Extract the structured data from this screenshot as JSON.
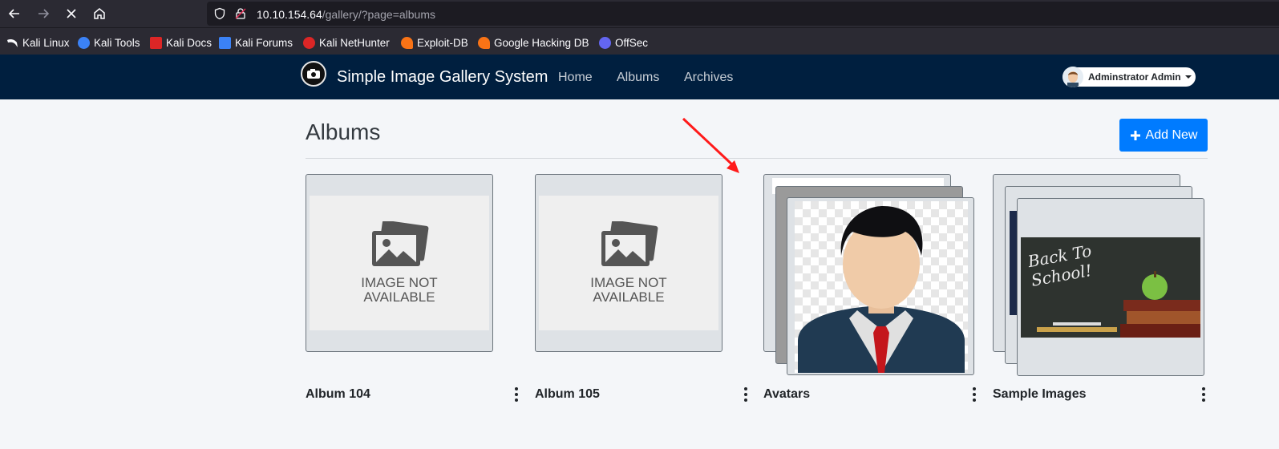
{
  "browser": {
    "url_host": "10.10.154.64",
    "url_path": "/gallery/?page=albums",
    "icons": [
      "back-icon",
      "forward-icon",
      "stop-icon",
      "home-icon",
      "shield-icon",
      "lock-icon"
    ],
    "bookmarks": [
      {
        "label": "Kali Linux",
        "icon": "kali-icon",
        "color": "#fbfbfe"
      },
      {
        "label": "Kali Tools",
        "icon": "kali-tools-icon",
        "color": "#3b82f6"
      },
      {
        "label": "Kali Docs",
        "icon": "kali-docs-icon",
        "color": "#dc2626"
      },
      {
        "label": "Kali Forums",
        "icon": "kali-forums-icon",
        "color": "#3b82f6"
      },
      {
        "label": "Kali NetHunter",
        "icon": "nethunter-icon",
        "color": "#dc2626"
      },
      {
        "label": "Exploit-DB",
        "icon": "exploit-db-icon",
        "color": "#f97316"
      },
      {
        "label": "Google Hacking DB",
        "icon": "ghdb-icon",
        "color": "#f97316"
      },
      {
        "label": "OffSec",
        "icon": "offsec-icon",
        "color": "#6366f1"
      }
    ]
  },
  "navbar": {
    "brand": "Simple Image Gallery System",
    "links": [
      "Home",
      "Albums",
      "Archives"
    ],
    "user": "Adminstrator Admin",
    "background": "#001f3f"
  },
  "main": {
    "title": "Albums",
    "add_button": "Add New",
    "accent": "#007bff",
    "placeholder_text": "IMAGE NOT AVAILABLE",
    "albums": [
      {
        "name": "Album 104",
        "thumbnail": "image-not-available"
      },
      {
        "name": "Album 105",
        "thumbnail": "image-not-available"
      },
      {
        "name": "Avatars",
        "thumbnail": "avatar-stack"
      },
      {
        "name": "Sample Images",
        "thumbnail": "back-to-school-stack"
      }
    ],
    "chalkboard_text": "Back To School!"
  }
}
